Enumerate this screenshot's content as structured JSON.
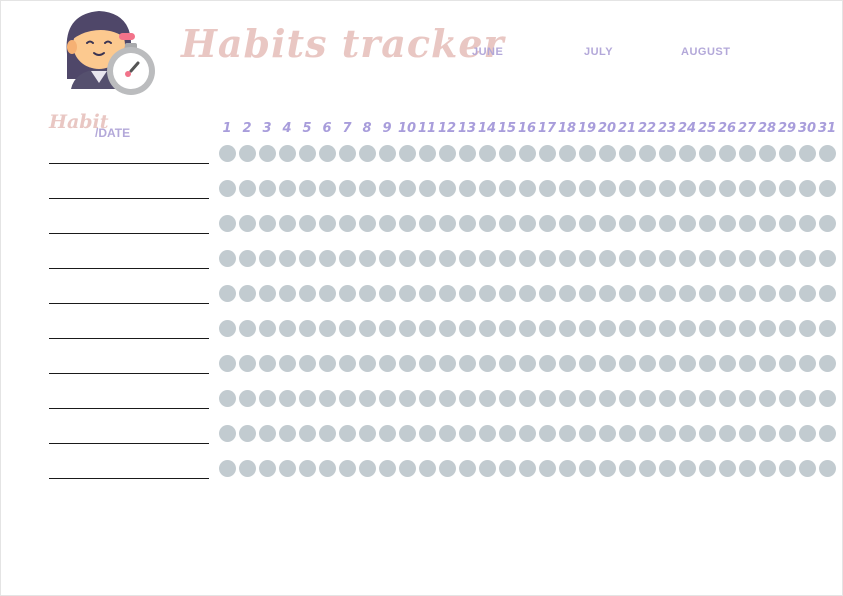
{
  "header": {
    "title": "Habits tracker",
    "months": [
      "JUNE",
      "JULY",
      "AUGUST"
    ]
  },
  "grid": {
    "habit_label": "Habit",
    "date_label": "/DATE",
    "days": [
      "1",
      "2",
      "3",
      "4",
      "5",
      "6",
      "7",
      "8",
      "9",
      "10",
      "11",
      "12",
      "13",
      "14",
      "15",
      "16",
      "17",
      "18",
      "19",
      "20",
      "21",
      "22",
      "23",
      "24",
      "25",
      "26",
      "27",
      "28",
      "29",
      "30",
      "31"
    ],
    "habit_rows": 10
  },
  "colors": {
    "title": "#e9c7c3",
    "accent_purple": "#b3a8d9",
    "dot": "#c2cbd0"
  },
  "icons": [
    "stopwatch-woman-avatar-icon"
  ]
}
